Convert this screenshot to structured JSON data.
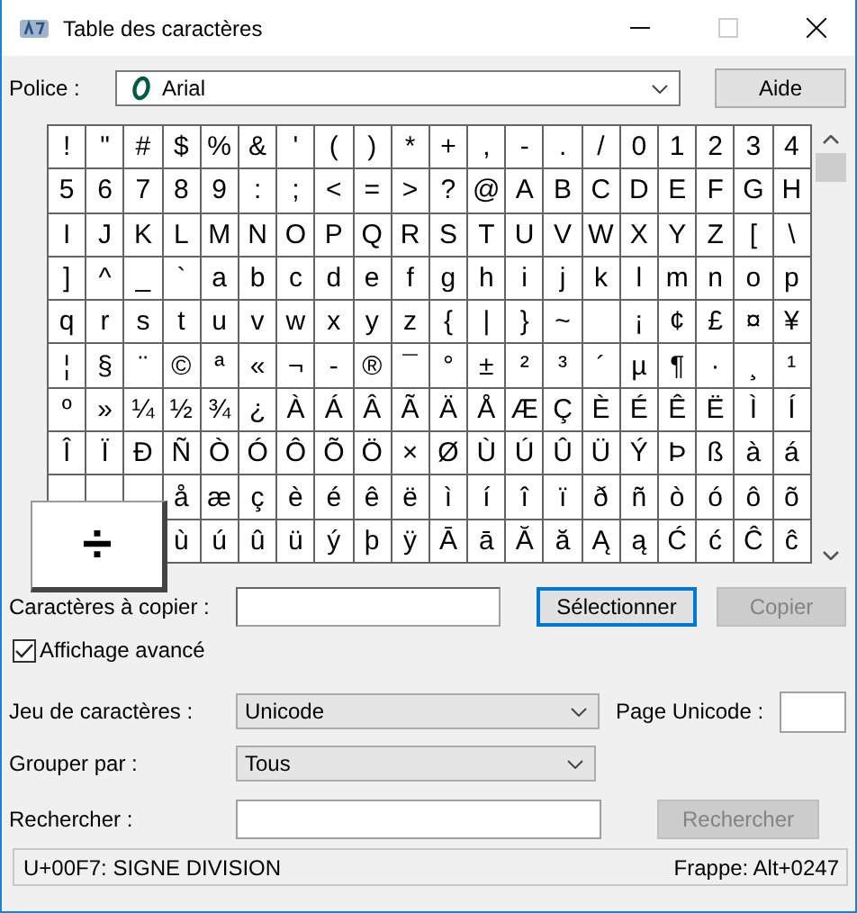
{
  "window": {
    "title": "Table des caractères"
  },
  "font": {
    "label": "Police :",
    "value": "Arial",
    "help_button": "Aide"
  },
  "grid": {
    "rows": [
      [
        "!",
        "\"",
        "#",
        "$",
        "%",
        "&",
        "'",
        "(",
        ")",
        "*",
        "+",
        ",",
        "-",
        ".",
        "/",
        "0",
        "1",
        "2",
        "3",
        "4"
      ],
      [
        "5",
        "6",
        "7",
        "8",
        "9",
        ":",
        ";",
        "<",
        "=",
        ">",
        "?",
        "@",
        "A",
        "B",
        "C",
        "D",
        "E",
        "F",
        "G",
        "H"
      ],
      [
        "I",
        "J",
        "K",
        "L",
        "M",
        "N",
        "O",
        "P",
        "Q",
        "R",
        "S",
        "T",
        "U",
        "V",
        "W",
        "X",
        "Y",
        "Z",
        "[",
        "\\"
      ],
      [
        "]",
        "^",
        "_",
        "`",
        "a",
        "b",
        "c",
        "d",
        "e",
        "f",
        "g",
        "h",
        "i",
        "j",
        "k",
        "l",
        "m",
        "n",
        "o",
        "p"
      ],
      [
        "q",
        "r",
        "s",
        "t",
        "u",
        "v",
        "w",
        "x",
        "y",
        "z",
        "{",
        "|",
        "}",
        "~",
        null,
        "¡",
        "¢",
        "£",
        "¤",
        "¥"
      ],
      [
        "¦",
        "§",
        "¨",
        "©",
        "ª",
        "«",
        "¬",
        "-",
        "®",
        "¯",
        "°",
        "±",
        "²",
        "³",
        "´",
        "µ",
        "¶",
        "·",
        "¸",
        "¹"
      ],
      [
        "º",
        "»",
        "¼",
        "½",
        "¾",
        "¿",
        "À",
        "Á",
        "Â",
        "Ã",
        "Ä",
        "Å",
        "Æ",
        "Ç",
        "È",
        "É",
        "Ê",
        "Ë",
        "Ì",
        "Í"
      ],
      [
        "Î",
        "Ï",
        "Ð",
        "Ñ",
        "Ò",
        "Ó",
        "Ô",
        "Õ",
        "Ö",
        "×",
        "Ø",
        "Ù",
        "Ú",
        "Û",
        "Ü",
        "Ý",
        "Þ",
        "ß",
        "à",
        "á"
      ],
      [
        "",
        "",
        "",
        "å",
        "æ",
        "ç",
        "è",
        "é",
        "ê",
        "ë",
        "ì",
        "í",
        "î",
        "ï",
        "ð",
        "ñ",
        "ò",
        "ó",
        "ô",
        "õ"
      ],
      [
        "",
        "",
        "",
        "ù",
        "ú",
        "û",
        "ü",
        "ý",
        "þ",
        "ÿ",
        "Ā",
        "ā",
        "Ă",
        "ă",
        "Ą",
        "ą",
        "Ć",
        "ć",
        "Ĉ",
        "ĉ"
      ]
    ],
    "preview": "÷"
  },
  "copy": {
    "label": "Caractères à copier :",
    "select_button": "Sélectionner",
    "copy_button": {
      "label": "Copier",
      "disabled": true
    }
  },
  "advanced_view": {
    "label": "Affichage avancé",
    "checked": true
  },
  "charset": {
    "label": "Jeu de caractères :",
    "value": "Unicode"
  },
  "unicode_page": {
    "label": "Page Unicode :"
  },
  "group_by": {
    "label": "Grouper par :",
    "value": "Tous"
  },
  "search": {
    "label": "Rechercher :",
    "button": {
      "label": "Rechercher",
      "disabled": true
    }
  },
  "status_bar": {
    "left": "U+00F7: SIGNE DIVISION",
    "right": "Frappe: Alt+0247"
  }
}
